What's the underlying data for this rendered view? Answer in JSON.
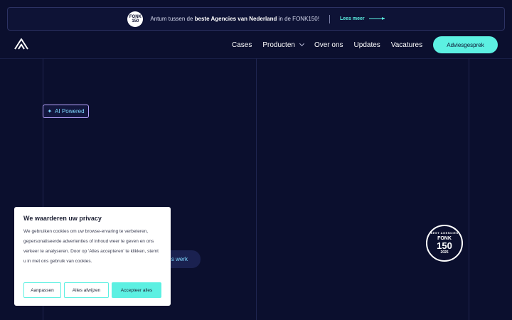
{
  "announcement": {
    "badge_top": "FONK",
    "badge_num": "150",
    "text_prefix": "Antum tussen de ",
    "text_bold": "beste Agencies van Nederland",
    "text_suffix": " in de FONK150!",
    "link_label": "Lees meer"
  },
  "nav": {
    "items": [
      {
        "label": "Cases"
      },
      {
        "label": "Producten",
        "has_dropdown": true
      },
      {
        "label": "Over ons"
      },
      {
        "label": "Updates"
      },
      {
        "label": "Vacatures"
      }
    ],
    "cta_label": "Adviesgesprek"
  },
  "hero": {
    "ai_badge_label": "AI Powered",
    "peek_text": ",",
    "peek_button_label": "s werk"
  },
  "award_badge": {
    "top": "BEST AGENCIES",
    "fonk": "FONK",
    "number": "150",
    "year": "2025"
  },
  "cookie_banner": {
    "title": "We waarderen uw privacy",
    "body": "We gebruiken cookies om uw browse-ervaring te verbeteren, gepersonaliseerde advertenties of inhoud weer te geven en ons verkeer te analyseren. Door op 'Alles accepteren' te klikken, stemt u in met ons gebruik van cookies.",
    "buttons": {
      "customize": "Aanpassen",
      "reject": "Alles afwijzen",
      "accept": "Accepteer alles"
    }
  },
  "colors": {
    "background": "#0b0f2e",
    "accent": "#5cf0e2",
    "ai_border": "#b9a5ff"
  }
}
